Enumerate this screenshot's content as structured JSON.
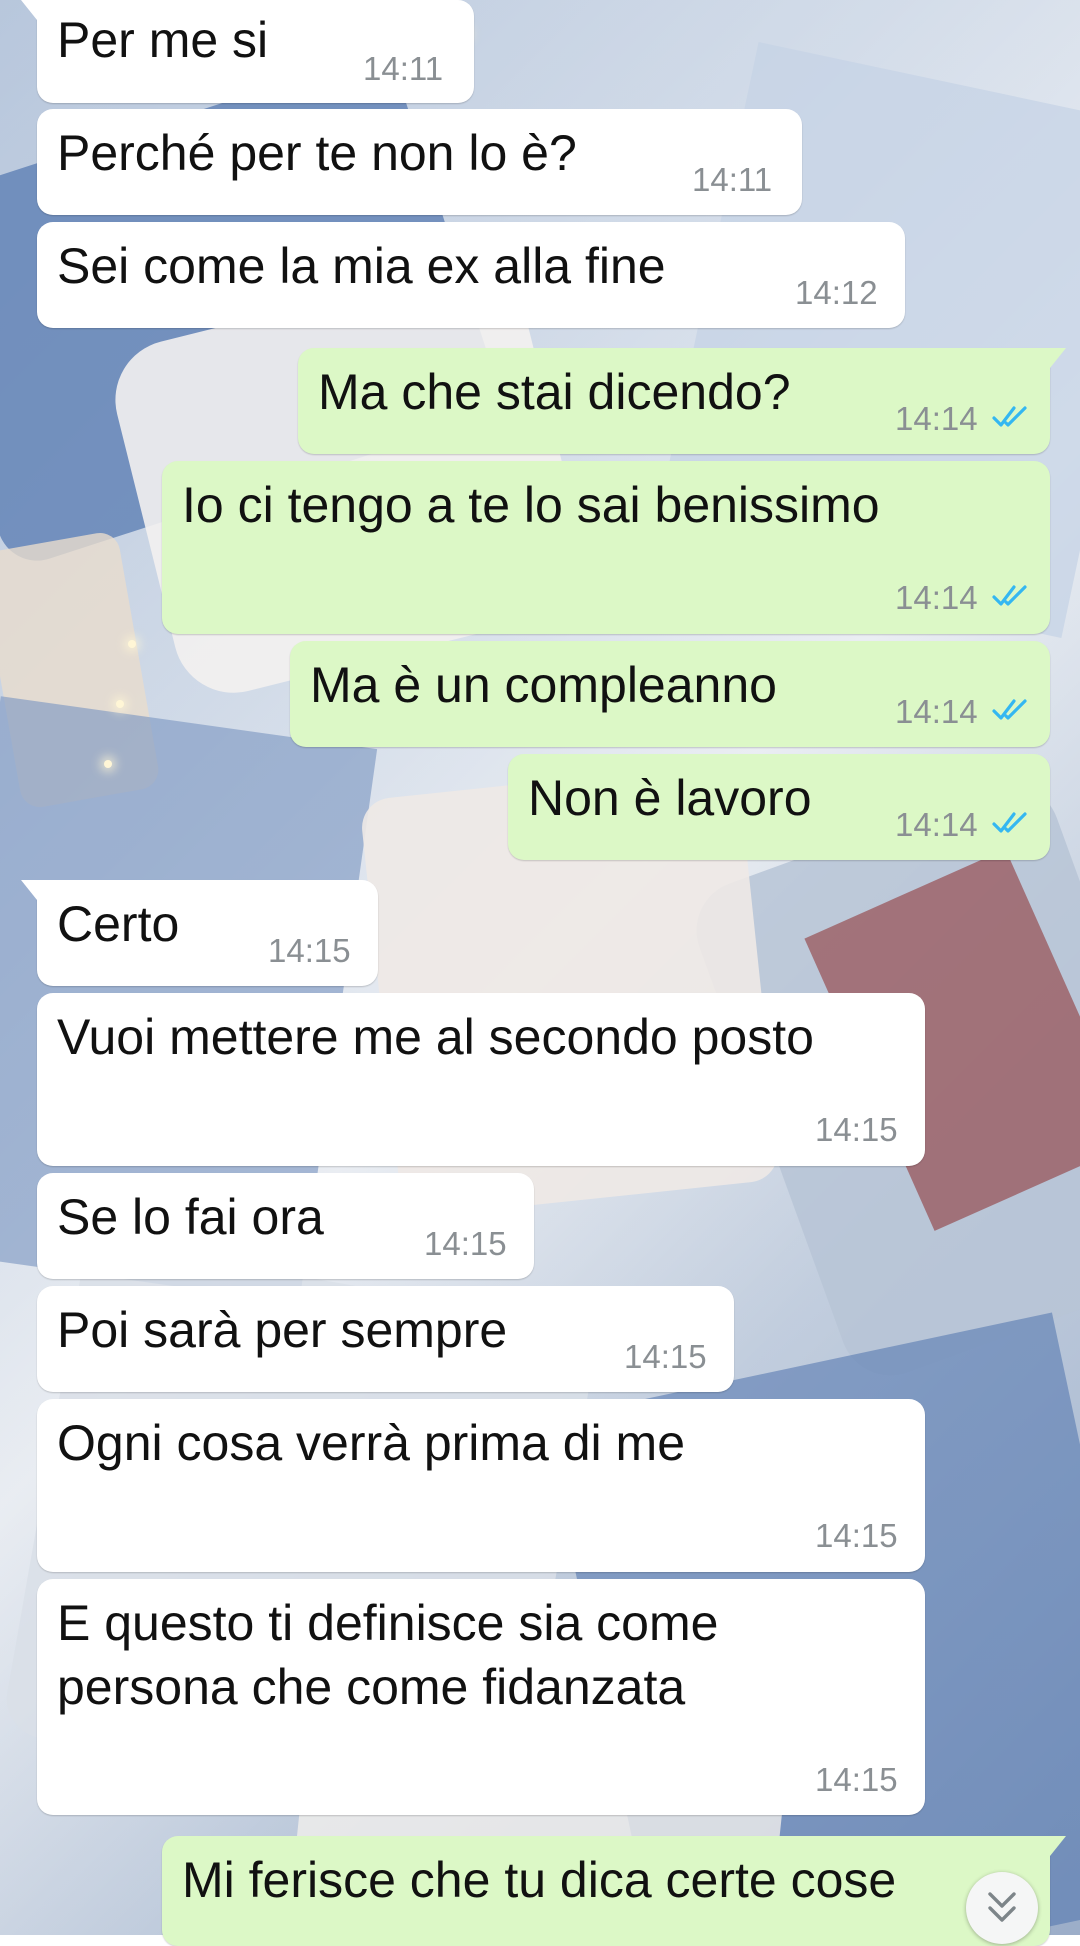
{
  "conversation": {
    "messages": [
      {
        "direction": "in",
        "text": "Per me si",
        "time": "14:11"
      },
      {
        "direction": "in",
        "text": "Perché per te non lo è?",
        "time": "14:11"
      },
      {
        "direction": "in",
        "text": "Sei come la mia ex alla fine",
        "time": "14:12"
      },
      {
        "direction": "out",
        "text": "Ma che stai dicendo?",
        "time": "14:14",
        "status": "read"
      },
      {
        "direction": "out",
        "text": "Io ci tengo a te lo sai benissimo",
        "time": "14:14",
        "status": "read"
      },
      {
        "direction": "out",
        "text": "Ma è un compleanno",
        "time": "14:14",
        "status": "read"
      },
      {
        "direction": "out",
        "text": "Non è lavoro",
        "time": "14:14",
        "status": "read"
      },
      {
        "direction": "in",
        "text": "Certo",
        "time": "14:15"
      },
      {
        "direction": "in",
        "text": "Vuoi mettere me al secondo posto",
        "time": "14:15"
      },
      {
        "direction": "in",
        "text": "Se lo fai ora",
        "time": "14:15"
      },
      {
        "direction": "in",
        "text": "Poi sarà per sempre",
        "time": "14:15"
      },
      {
        "direction": "in",
        "text": "Ogni cosa verrà prima di me",
        "time": "14:15"
      },
      {
        "direction": "in",
        "text": "E questo ti definisce sia come\npersona che come fidanzata",
        "time": "14:15"
      },
      {
        "direction": "out",
        "text": "Mi ferisce che tu dica certe cose",
        "time": ""
      }
    ]
  },
  "colors": {
    "incoming_bubble": "#ffffff",
    "outgoing_bubble": "#dcf8c6",
    "read_ticks": "#34b7f1",
    "timestamp": "#8a8f93"
  },
  "icons": {
    "read_receipt": "double-check-icon",
    "scroll_down": "double-chevron-down-icon"
  }
}
